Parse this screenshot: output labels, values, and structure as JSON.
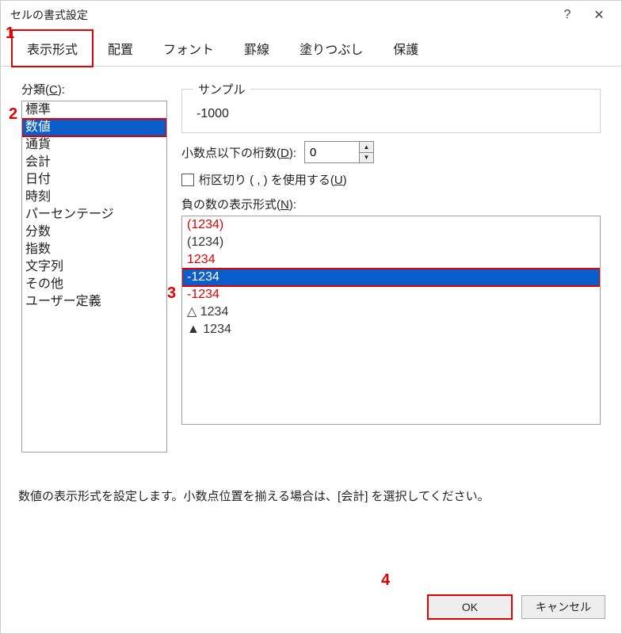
{
  "window": {
    "title": "セルの書式設定",
    "help": "?",
    "close": "✕"
  },
  "tabs": [
    {
      "label": "表示形式",
      "active": true
    },
    {
      "label": "配置",
      "active": false
    },
    {
      "label": "フォント",
      "active": false
    },
    {
      "label": "罫線",
      "active": false
    },
    {
      "label": "塗りつぶし",
      "active": false
    },
    {
      "label": "保護",
      "active": false
    }
  ],
  "category": {
    "label_prefix": "分類(",
    "label_key": "C",
    "label_suffix": "):",
    "items": [
      {
        "label": "標準",
        "selected": false
      },
      {
        "label": "数値",
        "selected": true
      },
      {
        "label": "通貨",
        "selected": false
      },
      {
        "label": "会計",
        "selected": false
      },
      {
        "label": "日付",
        "selected": false
      },
      {
        "label": "時刻",
        "selected": false
      },
      {
        "label": "パーセンテージ",
        "selected": false
      },
      {
        "label": "分数",
        "selected": false
      },
      {
        "label": "指数",
        "selected": false
      },
      {
        "label": "文字列",
        "selected": false
      },
      {
        "label": "その他",
        "selected": false
      },
      {
        "label": "ユーザー定義",
        "selected": false
      }
    ]
  },
  "sample": {
    "legend": "サンプル",
    "value": "-1000"
  },
  "decimals": {
    "label_prefix": "小数点以下の桁数(",
    "label_key": "D",
    "label_suffix": "):",
    "value": "0"
  },
  "thousands": {
    "label_prefix": "桁区切り ( , ) を使用する(",
    "label_key": "U",
    "label_suffix": ")",
    "checked": false
  },
  "negative": {
    "label_prefix": "負の数の表示形式(",
    "label_key": "N",
    "label_suffix": "):",
    "items": [
      {
        "label": "(1234)",
        "red": true,
        "selected": false
      },
      {
        "label": "(1234)",
        "red": false,
        "selected": false
      },
      {
        "label": "1234",
        "red": true,
        "selected": false
      },
      {
        "label": "-1234",
        "red": false,
        "selected": true
      },
      {
        "label": "-1234",
        "red": true,
        "selected": false
      },
      {
        "label": "△ 1234",
        "red": false,
        "selected": false
      },
      {
        "label": "▲ 1234",
        "red": false,
        "selected": false
      }
    ]
  },
  "description": "数値の表示形式を設定します。小数点位置を揃える場合は、[会計] を選択してください。",
  "buttons": {
    "ok": "OK",
    "cancel": "キャンセル"
  },
  "annotations": {
    "a1": "1",
    "a2": "2",
    "a3": "3",
    "a4": "4"
  }
}
